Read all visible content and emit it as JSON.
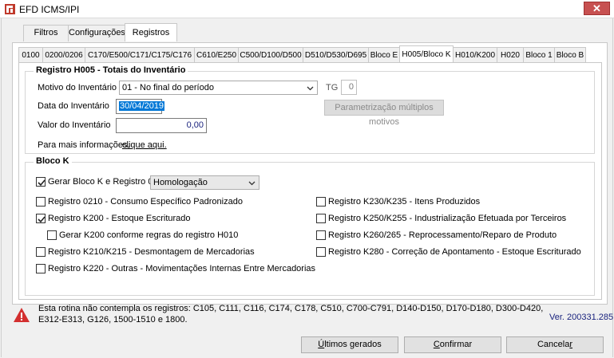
{
  "window": {
    "title": "EFD ICMS/IPI",
    "close_glyph": "✕"
  },
  "outer_tabs": [
    {
      "label": "Filtros",
      "active": false
    },
    {
      "label": "Configurações",
      "active": false
    },
    {
      "label": "Registros",
      "active": true
    }
  ],
  "inner_tabs": [
    {
      "label": "0100"
    },
    {
      "label": "0200/0206"
    },
    {
      "label": "C170/E500/C171/C175/C176"
    },
    {
      "label": "C610/E250"
    },
    {
      "label": "C500/D100/D500"
    },
    {
      "label": "D510/D530/D695"
    },
    {
      "label": "Bloco E"
    },
    {
      "label": "H005/Bloco K",
      "active": true
    },
    {
      "label": "H010/K200"
    },
    {
      "label": "H020"
    },
    {
      "label": "Bloco 1"
    },
    {
      "label": "Bloco B"
    }
  ],
  "h005": {
    "title": "Registro H005 - Totais do Inventário",
    "motivo_label": "Motivo do Inventário",
    "motivo_value": "01 - No final do período",
    "tg_label": "TG",
    "tg_value": "0",
    "data_label": "Data do Inventário",
    "data_value": "30/04/2019",
    "parametrizacao_label": "Parametrização múltiplos motivos",
    "valor_label": "Valor do Inventário",
    "valor_value": "0,00",
    "info_label": "Para mais informações,",
    "info_link": "clique aqui."
  },
  "bloco_k": {
    "title": "Bloco K",
    "gerar": {
      "label": "Gerar Bloco K e Registro 0210",
      "checked": true
    },
    "ambiente_value": "Homologação",
    "left_checks": [
      {
        "label": "Registro 0210 - Consumo Específico Padronizado",
        "checked": false
      },
      {
        "label": "Registro K200 - Estoque Escriturado",
        "checked": true
      },
      {
        "label": "Gerar K200 conforme regras do registro H010",
        "checked": false
      },
      {
        "label": "Registro K210/K215 - Desmontagem de Mercadorias",
        "checked": false
      },
      {
        "label": "Registro K220 - Outras - Movimentações Internas Entre Mercadorias",
        "checked": false
      }
    ],
    "right_checks": [
      {
        "label": "Registro K230/K235 - Itens Produzidos",
        "checked": false
      },
      {
        "label": "Registro K250/K255 - Industrialização Efetuada por Terceiros",
        "checked": false
      },
      {
        "label": "Registro K260/265 - Reprocessamento/Reparo de Produto",
        "checked": false
      },
      {
        "label": "Registro K280 - Correção de Apontamento - Estoque Escriturado",
        "checked": false
      }
    ]
  },
  "footer": {
    "note": "Esta rotina não contempla os registros: C105, C111, C116, C174, C178, C510, C700-C791, D140-D150, D170-D180, D300-D420, E312-E313, G126, 1500-1510 e 1800.",
    "version": "Ver. 200331.285"
  },
  "buttons": {
    "ultimos_mnemonic": "Ú",
    "ultimos_rest": "ltimos gerados",
    "confirmar_mnemonic": "C",
    "confirmar_rest": "onfirmar",
    "cancelar_text": "Cancela",
    "cancelar_mnemonic": "r"
  },
  "colors": {
    "accent": "#0078d7",
    "close": "#c75050",
    "version": "#1a237e",
    "warning": "#d32f2f"
  },
  "icons": [
    "app-icon",
    "close-icon",
    "chevron-down-icon",
    "checkmark-icon",
    "warning-icon"
  ]
}
